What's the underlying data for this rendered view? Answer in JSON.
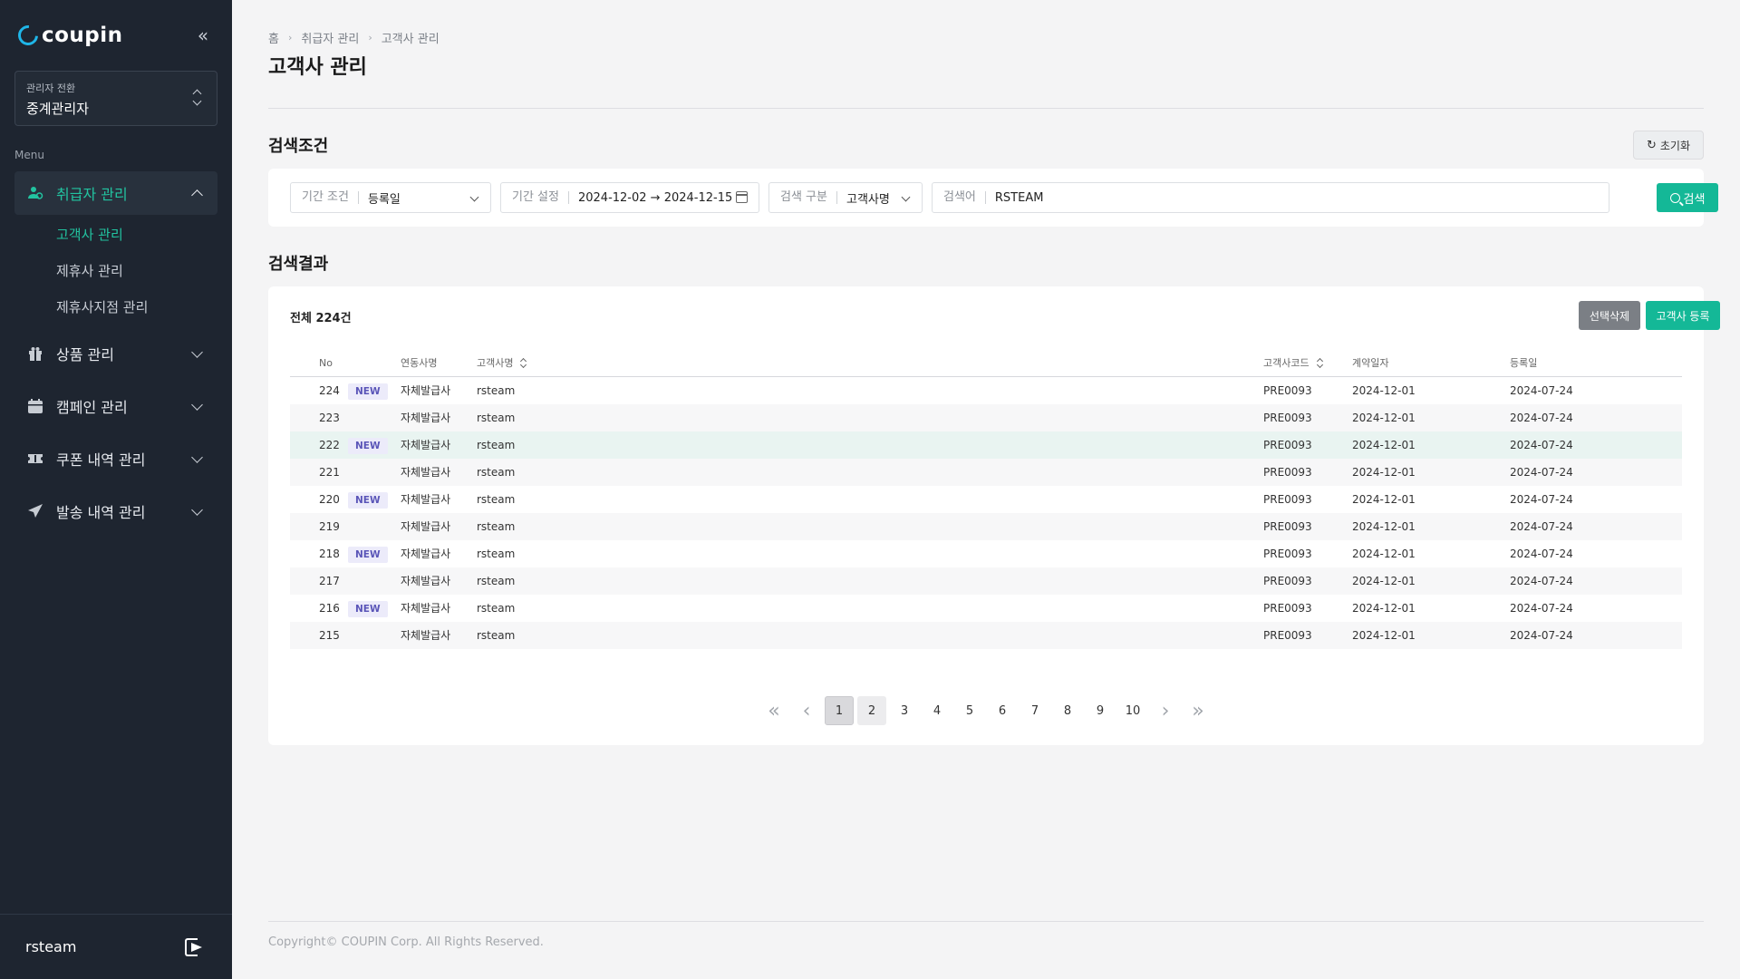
{
  "brand": {
    "name": "coupin"
  },
  "sidebar": {
    "admin_switch": {
      "label": "관리자 전환",
      "value": "중계관리자"
    },
    "menu_label": "Menu",
    "nav": [
      {
        "label": "취급자 관리",
        "icon": "user-group-icon",
        "active": true,
        "sub": [
          {
            "label": "고객사 관리",
            "active": true
          },
          {
            "label": "제휴사 관리"
          },
          {
            "label": "제휴사지점 관리"
          }
        ]
      },
      {
        "label": "상품 관리",
        "icon": "gift-icon"
      },
      {
        "label": "캠페인 관리",
        "icon": "calendar-icon"
      },
      {
        "label": "쿠폰 내역 관리",
        "icon": "ticket-icon"
      },
      {
        "label": "발송 내역 관리",
        "icon": "send-icon"
      }
    ],
    "user": {
      "name": "rsteam"
    }
  },
  "breadcrumb": [
    "홈",
    "취급자 관리",
    "고객사 관리"
  ],
  "page_title": "고객사 관리",
  "search": {
    "title": "검색조건",
    "reset_label": "초기화",
    "period_condition": {
      "label": "기간 조건",
      "value": "등록일"
    },
    "period_setting": {
      "label": "기간 설정",
      "value": "2024-12-02 → 2024-12-15"
    },
    "search_type": {
      "label": "검색 구분",
      "value": "고객사명"
    },
    "keyword": {
      "label": "검색어",
      "value": "RSTEAM"
    },
    "search_label": "검색"
  },
  "results": {
    "title": "검색결과",
    "total": "전체 224건",
    "delete_label": "선택삭제",
    "add_label": "고객사 등록",
    "columns": {
      "no": "No",
      "link": "연동사명",
      "name": "고객사명",
      "code": "고객사코드",
      "contract": "계약일자",
      "registered": "등록일"
    },
    "rows": [
      {
        "no": "224",
        "badge": "NEW",
        "link": "자체발급사",
        "name": "rsteam",
        "code": "PRE0093",
        "contract": "2024-12-01",
        "registered": "2024-07-24"
      },
      {
        "no": "223",
        "badge": "",
        "link": "자체발급사",
        "name": "rsteam",
        "code": "PRE0093",
        "contract": "2024-12-01",
        "registered": "2024-07-24"
      },
      {
        "no": "222",
        "badge": "NEW",
        "link": "자체발급사",
        "name": "rsteam",
        "code": "PRE0093",
        "contract": "2024-12-01",
        "registered": "2024-07-24"
      },
      {
        "no": "221",
        "badge": "",
        "link": "자체발급사",
        "name": "rsteam",
        "code": "PRE0093",
        "contract": "2024-12-01",
        "registered": "2024-07-24"
      },
      {
        "no": "220",
        "badge": "NEW",
        "link": "자체발급사",
        "name": "rsteam",
        "code": "PRE0093",
        "contract": "2024-12-01",
        "registered": "2024-07-24"
      },
      {
        "no": "219",
        "badge": "",
        "link": "자체발급사",
        "name": "rsteam",
        "code": "PRE0093",
        "contract": "2024-12-01",
        "registered": "2024-07-24"
      },
      {
        "no": "218",
        "badge": "NEW",
        "link": "자체발급사",
        "name": "rsteam",
        "code": "PRE0093",
        "contract": "2024-12-01",
        "registered": "2024-07-24"
      },
      {
        "no": "217",
        "badge": "",
        "link": "자체발급사",
        "name": "rsteam",
        "code": "PRE0093",
        "contract": "2024-12-01",
        "registered": "2024-07-24"
      },
      {
        "no": "216",
        "badge": "NEW",
        "link": "자체발급사",
        "name": "rsteam",
        "code": "PRE0093",
        "contract": "2024-12-01",
        "registered": "2024-07-24"
      },
      {
        "no": "215",
        "badge": "",
        "link": "자체발급사",
        "name": "rsteam",
        "code": "PRE0093",
        "contract": "2024-12-01",
        "registered": "2024-07-24"
      }
    ],
    "pagination": {
      "current": "1",
      "pages": [
        "1",
        "2",
        "3",
        "4",
        "5",
        "6",
        "7",
        "8",
        "9",
        "10"
      ]
    }
  },
  "footer": {
    "copyright": "Copyright© COUPIN Corp. All Rights Reserved."
  }
}
